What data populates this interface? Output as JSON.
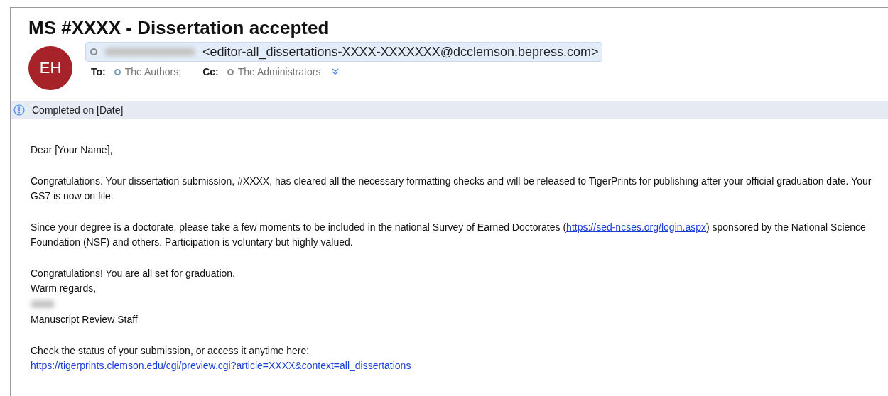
{
  "subject": "MS #XXXX - Dissertation accepted",
  "avatar": {
    "initials": "EH"
  },
  "sender": {
    "name_redacted": true,
    "address": "<editor-all_dissertations-XXXX-XXXXXXX@dcclemson.bepress.com>"
  },
  "recipients": [
    {
      "label": "To:",
      "names": [
        {
          "name": "The Authors;",
          "color": "#7a9cae"
        }
      ]
    },
    {
      "label": "Cc:",
      "names": [
        {
          "name": "The Administrators",
          "color": "#8a8a8a"
        }
      ]
    }
  ],
  "more_recipients": {
    "expanded": false
  },
  "info_bar": {
    "text": "Completed on [Date]"
  },
  "body": [
    {
      "lines": [
        {
          "kind": "text",
          "text": "Dear [Your Name],"
        }
      ]
    },
    {
      "lines": [
        {
          "kind": "text",
          "text": "Congratulations. Your dissertation submission, #XXXX, has cleared all the necessary formatting checks and will be released to TigerPrints for publishing after your official graduation date. Your GS7 is now on file."
        }
      ]
    },
    {
      "lines": [
        {
          "kind": "mixed",
          "parts": [
            {
              "kind": "text",
              "text": "Since your degree is a doctorate, please take a few moments to be included in the national Survey of Earned Doctorates ("
            },
            {
              "kind": "link",
              "text": "https://sed-ncses.org/login.aspx"
            },
            {
              "kind": "text",
              "text": ") sponsored by the National Science Foundation (NSF) and others. Participation is voluntary but highly valued."
            }
          ]
        }
      ]
    },
    {
      "lines": [
        {
          "kind": "text",
          "text": "Congratulations! You are all set for graduation."
        },
        {
          "kind": "text",
          "text": "Warm regards,"
        },
        {
          "kind": "redacted"
        },
        {
          "kind": "text",
          "text": "Manuscript Review Staff"
        }
      ]
    },
    {
      "lines": [
        {
          "kind": "text",
          "text": "Check the status of your submission, or access it anytime here:"
        },
        {
          "kind": "link",
          "text": "https://tigerprints.clemson.edu/cgi/preview.cgi?article=XXXX&context=all_dissertations"
        }
      ]
    }
  ]
}
